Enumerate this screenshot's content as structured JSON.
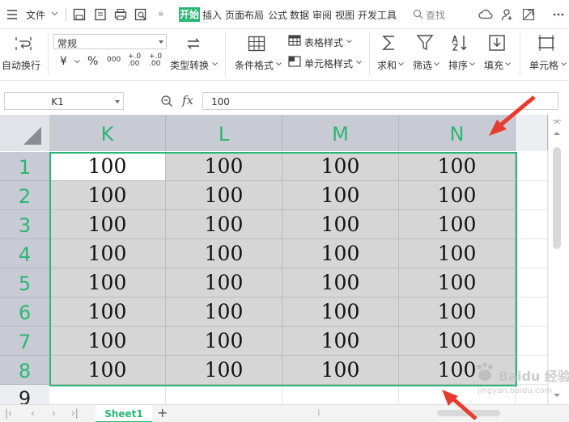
{
  "menubar": {
    "file_label": "文件",
    "tabs": [
      {
        "label": "开始",
        "active": true
      },
      {
        "label": "插入"
      },
      {
        "label": "页面布局"
      },
      {
        "label": "公式"
      },
      {
        "label": "数据"
      },
      {
        "label": "审阅"
      },
      {
        "label": "视图"
      },
      {
        "label": "开发工具"
      }
    ],
    "search_label": "查找",
    "more_label": "»"
  },
  "ribbon": {
    "wrap_label": "自动换行",
    "number_format": "常规",
    "currency_symbol": "¥",
    "percent_symbol": "%",
    "thousands_label": "000",
    "dec_increase_label": "+.0 .00",
    "dec_decrease_label": "+.0 .00",
    "type_convert_label": "类型转换",
    "cond_format_label": "条件格式",
    "table_style_label": "表格样式",
    "cell_style_label": "单元格样式",
    "sum_label": "求和",
    "filter_label": "筛选",
    "sort_label": "排序",
    "fill_label": "填充",
    "cells_label": "单元格"
  },
  "formula_bar": {
    "name_box": "K1",
    "fx_label": "fx",
    "value": "100"
  },
  "grid": {
    "columns": [
      "K",
      "L",
      "M",
      "N"
    ],
    "rows": [
      {
        "header": "1",
        "cells": [
          "100",
          "100",
          "100",
          "100"
        ]
      },
      {
        "header": "2",
        "cells": [
          "100",
          "100",
          "100",
          "100"
        ]
      },
      {
        "header": "3",
        "cells": [
          "100",
          "100",
          "100",
          "100"
        ]
      },
      {
        "header": "4",
        "cells": [
          "100",
          "100",
          "100",
          "100"
        ]
      },
      {
        "header": "5",
        "cells": [
          "100",
          "100",
          "100",
          "100"
        ]
      },
      {
        "header": "6",
        "cells": [
          "100",
          "100",
          "100",
          "100"
        ]
      },
      {
        "header": "7",
        "cells": [
          "100",
          "100",
          "100",
          "100"
        ]
      },
      {
        "header": "8",
        "cells": [
          "100",
          "100",
          "100",
          "100"
        ]
      }
    ],
    "extra_row_header": "9",
    "active_cell": "K1"
  },
  "sheets": {
    "tabs": [
      "Sheet1"
    ],
    "add_label": "+"
  },
  "watermark": {
    "text": "Baidu 经验",
    "sub": "jingyan.baidu.com"
  },
  "colors": {
    "accent": "#2bb673",
    "arrow": "#e63b2e",
    "selection_fill": "#d6d6d6",
    "header_selected": "#c8cbd3"
  }
}
